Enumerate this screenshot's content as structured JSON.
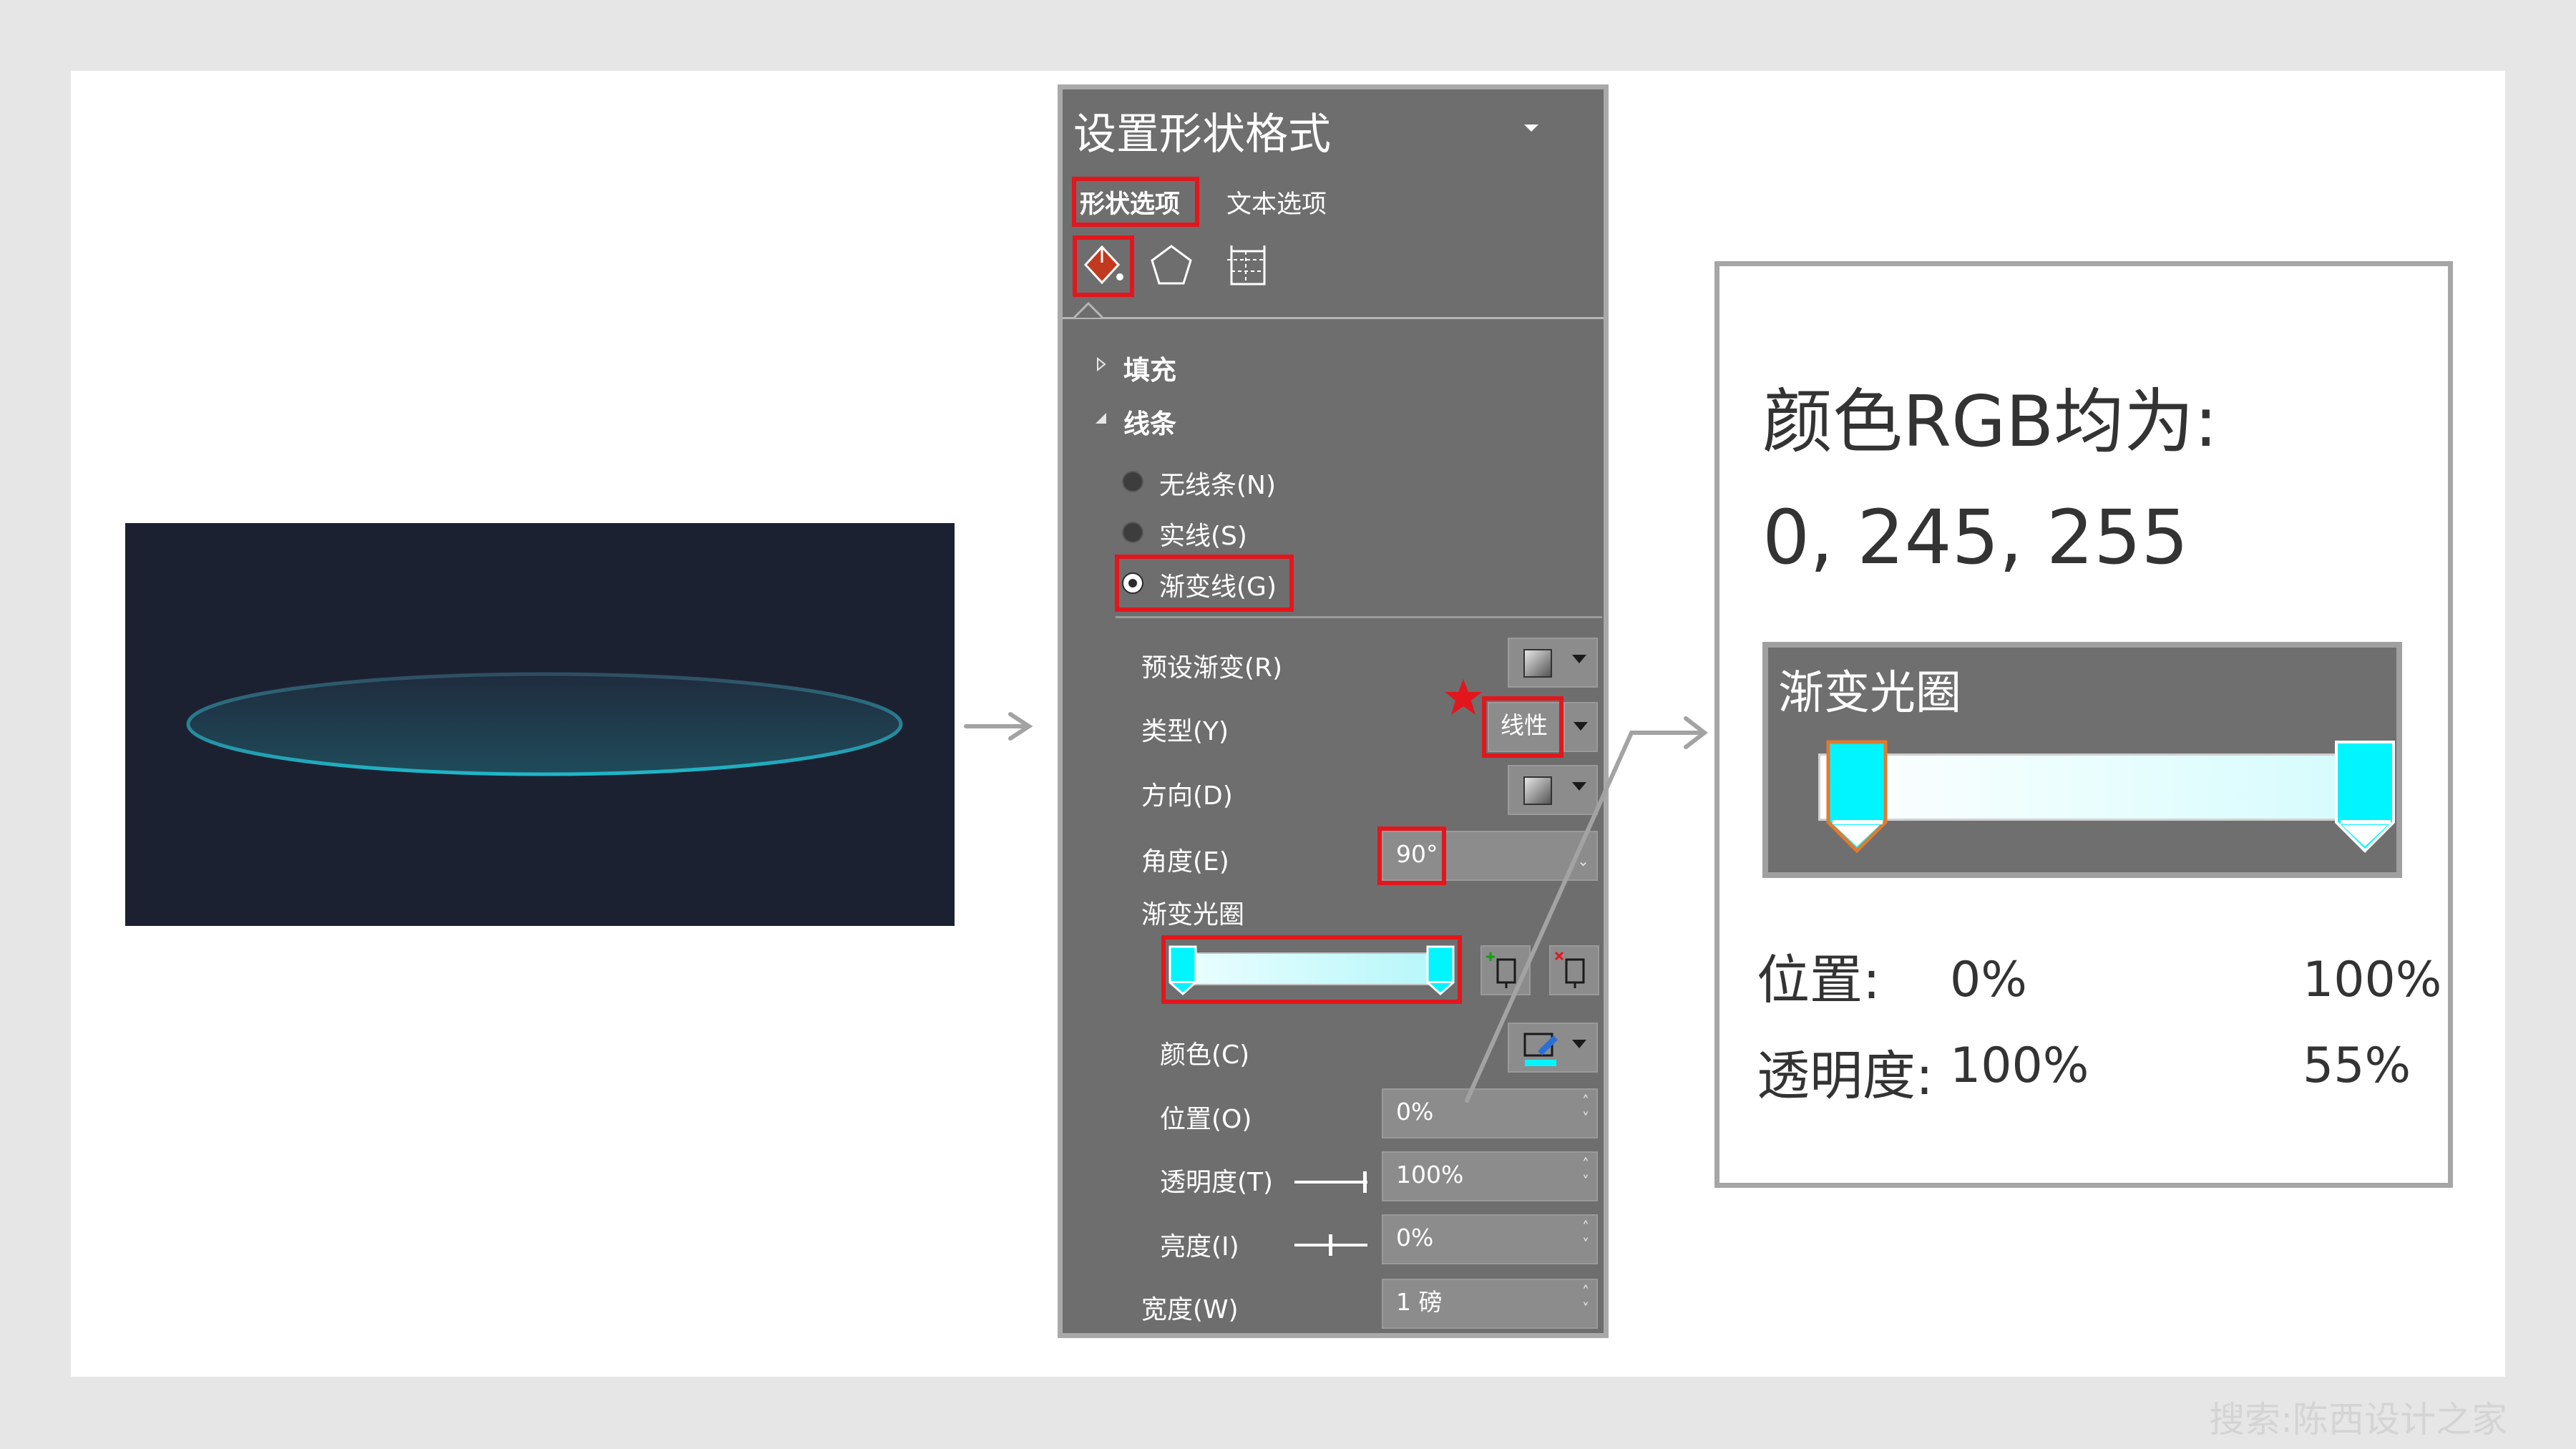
{
  "pane": {
    "title": "设置形状格式",
    "tabs": {
      "shape_options": "形状选项",
      "text_options": "文本选项"
    },
    "sections": {
      "fill": "填充",
      "line": "线条"
    },
    "line_types": {
      "none": "无线条(N)",
      "solid": "实线(S)",
      "gradient": "渐变线(G)",
      "selected": "gradient"
    },
    "labels": {
      "preset": "预设渐变(R)",
      "type": "类型(Y)",
      "direction": "方向(D)",
      "angle": "角度(E)",
      "stops": "渐变光圈",
      "color": "颜色(C)",
      "position": "位置(O)",
      "transparency": "透明度(T)",
      "brightness": "亮度(I)",
      "width": "宽度(W)"
    },
    "values": {
      "type": "线性",
      "angle": "90°",
      "position": "0%",
      "transparency": "100%",
      "brightness": "0%",
      "width": "1 磅"
    }
  },
  "info": {
    "heading": "颜色RGB均为:",
    "rgb": "0, 245, 255",
    "panel_title": "渐变光圈",
    "position_label": "位置:",
    "transparency_label": "透明度:",
    "stop1": {
      "position": "0%",
      "transparency": "100%"
    },
    "stop2": {
      "position": "100%",
      "transparency": "55%"
    }
  },
  "colors": {
    "accent": "#00f5ff",
    "highlight": "#e2161c",
    "pane_bg": "#6e6e6e",
    "preview_bg": "#1c2132"
  },
  "icons": [
    "dropdown-icon",
    "fill-line-icon",
    "effects-pentagon-icon",
    "size-properties-icon",
    "add-stop-icon",
    "remove-stop-icon",
    "pen-color-icon",
    "star-icon"
  ],
  "watermark": "搜索:陈西设计之家"
}
